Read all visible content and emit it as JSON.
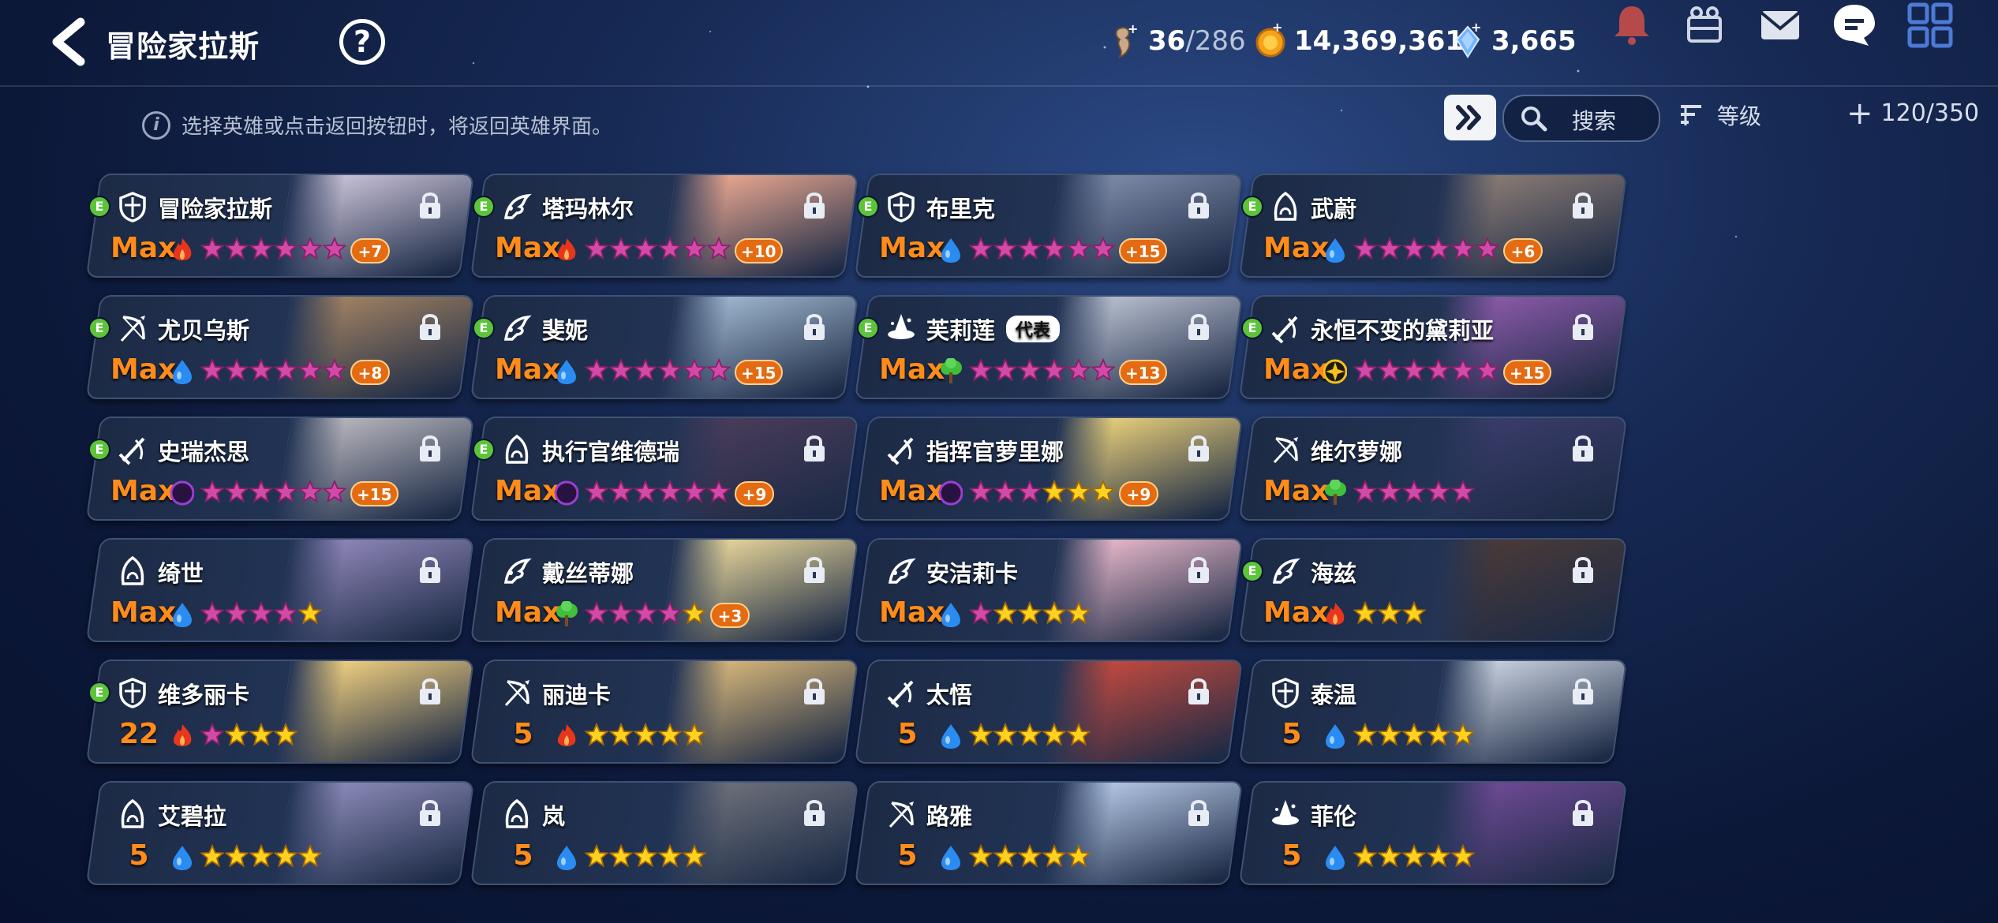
{
  "header": {
    "title": "冒险家拉斯",
    "help_icon": "?",
    "stamina_current": "36",
    "stamina_max": "/286",
    "gold": "14,369,361",
    "crystals": "3,665"
  },
  "toolbar": {
    "hint": "选择英雄或点击返回按钮时，将返回英雄界面。",
    "search_placeholder": "搜索",
    "sort_label": "等级",
    "hero_count": "120/350"
  },
  "colors": {
    "level_orange": "#ff8c1a",
    "water": "#2a8cf2",
    "fire": "#e8361c",
    "earth": "#3fbf3a",
    "dark": "#9b3fd4",
    "light": "#f2c21a",
    "badge": "#e46b12",
    "egrade": "#5cc43a"
  },
  "heroes": [
    {
      "name": "冒险家拉斯",
      "class": "knight-shield-icon",
      "level": "Max",
      "element": "fire",
      "stars": 6,
      "awakened": 6,
      "plus": "+7",
      "egrade": "E",
      "rep": "",
      "portrait": "#c9c2d8"
    },
    {
      "name": "塔玛林尔",
      "class": "mage-wing-icon",
      "level": "Max",
      "element": "fire",
      "stars": 6,
      "awakened": 6,
      "plus": "+10",
      "egrade": "E",
      "rep": "",
      "portrait": "#e8a790"
    },
    {
      "name": "布里克",
      "class": "knight-shield-icon",
      "level": "Max",
      "element": "water",
      "stars": 6,
      "awakened": 6,
      "plus": "+15",
      "egrade": "E",
      "rep": "",
      "portrait": "#7d8aa8"
    },
    {
      "name": "武蔚",
      "class": "assassin-hood-icon",
      "level": "Max",
      "element": "water",
      "stars": 6,
      "awakened": 6,
      "plus": "+6",
      "egrade": "E",
      "rep": "",
      "portrait": "#8a7b74"
    },
    {
      "name": "尤贝乌斯",
      "class": "archer-bow-icon",
      "level": "Max",
      "element": "water",
      "stars": 6,
      "awakened": 6,
      "plus": "+8",
      "egrade": "E",
      "rep": "",
      "portrait": "#a08262"
    },
    {
      "name": "斐妮",
      "class": "mage-wing-icon",
      "level": "Max",
      "element": "water",
      "stars": 6,
      "awakened": 6,
      "plus": "+15",
      "egrade": "E",
      "rep": "",
      "portrait": "#9fb6cf"
    },
    {
      "name": "芙莉莲",
      "class": "wizard-hat-icon",
      "level": "Max",
      "element": "earth",
      "stars": 6,
      "awakened": 6,
      "plus": "+13",
      "egrade": "E",
      "rep": "代表",
      "portrait": "#b9bfd0"
    },
    {
      "name": "永恒不变的黛莉亚",
      "class": "warrior-sword-icon",
      "level": "Max",
      "element": "light",
      "stars": 6,
      "awakened": 6,
      "plus": "+15",
      "egrade": "E",
      "rep": "",
      "portrait": "#8a5aa8"
    },
    {
      "name": "史瑞杰思",
      "class": "warrior-sword-icon",
      "level": "Max",
      "element": "dark",
      "stars": 6,
      "awakened": 6,
      "plus": "+15",
      "egrade": "E",
      "rep": "",
      "portrait": "#b8b6bd"
    },
    {
      "name": "执行官维德瑞",
      "class": "assassin-hood-icon",
      "level": "Max",
      "element": "dark",
      "stars": 6,
      "awakened": 6,
      "plus": "+9",
      "egrade": "E",
      "rep": "",
      "portrait": "#4a3c5a"
    },
    {
      "name": "指挥官萝里娜",
      "class": "warrior-sword-icon",
      "level": "Max",
      "element": "dark",
      "stars": 6,
      "awakened": 3,
      "plus": "+9",
      "egrade": "",
      "rep": "",
      "portrait": "#e8cf7a"
    },
    {
      "name": "维尔萝娜",
      "class": "archer-bow-icon",
      "level": "Max",
      "element": "earth",
      "stars": 5,
      "awakened": 5,
      "plus": "",
      "egrade": "",
      "rep": "",
      "portrait": "#3a3c6a"
    },
    {
      "name": "绮世",
      "class": "assassin-hood-icon",
      "level": "Max",
      "element": "water",
      "stars": 5,
      "awakened": 4,
      "plus": "",
      "egrade": "",
      "rep": "",
      "portrait": "#8e86b8"
    },
    {
      "name": "戴丝蒂娜",
      "class": "mage-wing-icon",
      "level": "Max",
      "element": "earth",
      "stars": 5,
      "awakened": 4,
      "plus": "+3",
      "egrade": "",
      "rep": "",
      "portrait": "#e6d59a"
    },
    {
      "name": "安洁莉卡",
      "class": "mage-wing-icon",
      "level": "Max",
      "element": "water",
      "stars": 5,
      "awakened": 1,
      "plus": "",
      "egrade": "",
      "rep": "",
      "portrait": "#e6b7c8"
    },
    {
      "name": "海兹",
      "class": "mage-wing-icon",
      "level": "Max",
      "element": "fire",
      "stars": 3,
      "awakened": 0,
      "plus": "",
      "egrade": "E",
      "rep": "",
      "portrait": "#4a3a38"
    },
    {
      "name": "维多丽卡",
      "class": "knight-shield-icon",
      "level": "22",
      "element": "fire",
      "stars": 4,
      "awakened": 1,
      "plus": "",
      "egrade": "E",
      "rep": "",
      "portrait": "#f0cf80"
    },
    {
      "name": "丽迪卡",
      "class": "archer-bow-icon",
      "level": "5",
      "element": "fire",
      "stars": 5,
      "awakened": 0,
      "plus": "",
      "egrade": "",
      "rep": "",
      "portrait": "#d6b67a"
    },
    {
      "name": "太悟",
      "class": "warrior-sword-icon",
      "level": "5",
      "element": "water",
      "stars": 5,
      "awakened": 0,
      "plus": "",
      "egrade": "",
      "rep": "",
      "portrait": "#c24a3e"
    },
    {
      "name": "泰温",
      "class": "knight-shield-icon",
      "level": "5",
      "element": "water",
      "stars": 5,
      "awakened": 0,
      "plus": "",
      "egrade": "",
      "rep": "",
      "portrait": "#c8d0de"
    },
    {
      "name": "艾碧拉",
      "class": "assassin-hood-icon",
      "level": "5",
      "element": "water",
      "stars": 5,
      "awakened": 0,
      "plus": "",
      "egrade": "",
      "rep": "",
      "portrait": "#8b8ab8"
    },
    {
      "name": "岚",
      "class": "assassin-hood-icon",
      "level": "5",
      "element": "water",
      "stars": 5,
      "awakened": 0,
      "plus": "",
      "egrade": "",
      "rep": "",
      "portrait": "#6c707a"
    },
    {
      "name": "路雅",
      "class": "archer-bow-icon",
      "level": "5",
      "element": "water",
      "stars": 5,
      "awakened": 0,
      "plus": "",
      "egrade": "",
      "rep": "",
      "portrait": "#b3c6e4"
    },
    {
      "name": "菲伦",
      "class": "wizard-hat-icon",
      "level": "5",
      "element": "water",
      "stars": 5,
      "awakened": 0,
      "plus": "",
      "egrade": "",
      "rep": "",
      "portrait": "#6e4a94"
    }
  ]
}
